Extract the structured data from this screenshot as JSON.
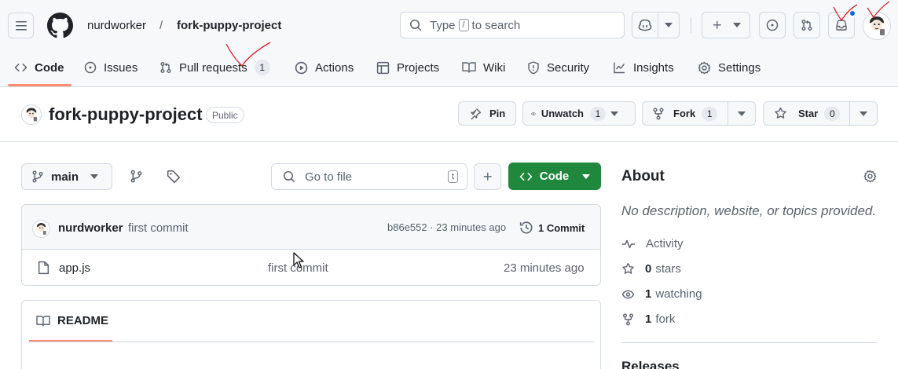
{
  "header": {
    "owner": "nurdworker",
    "separator": "/",
    "repo": "fork-puppy-project",
    "search_prefix": "Type",
    "search_key": "/",
    "search_suffix": "to search"
  },
  "nav": {
    "tabs": [
      {
        "label": "Code",
        "icon": "code-icon",
        "selected": true
      },
      {
        "label": "Issues",
        "icon": "issue-icon"
      },
      {
        "label": "Pull requests",
        "icon": "pull-request-icon",
        "count": "1"
      },
      {
        "label": "Actions",
        "icon": "play-icon"
      },
      {
        "label": "Projects",
        "icon": "table-icon"
      },
      {
        "label": "Wiki",
        "icon": "book-icon"
      },
      {
        "label": "Security",
        "icon": "shield-icon"
      },
      {
        "label": "Insights",
        "icon": "graph-icon"
      },
      {
        "label": "Settings",
        "icon": "gear-icon"
      }
    ]
  },
  "repo_header": {
    "name": "fork-puppy-project",
    "visibility": "Public",
    "pin_label": "Pin",
    "unwatch_label": "Unwatch",
    "unwatch_count": "1",
    "fork_label": "Fork",
    "fork_count": "1",
    "star_label": "Star",
    "star_count": "0"
  },
  "toolbar": {
    "branch": "main",
    "goto_placeholder": "Go to file",
    "goto_key": "t",
    "code_label": "Code"
  },
  "commit": {
    "author": "nurdworker",
    "message": "first commit",
    "hash_time": "b86e552 · 23 minutes ago",
    "commits_label": "1 Commit"
  },
  "files": [
    {
      "name": "app.js",
      "message": "first commit",
      "time": "23 minutes ago"
    }
  ],
  "readme": {
    "tab_label": "README"
  },
  "about": {
    "title": "About",
    "description": "No description, website, or topics provided.",
    "activity": "Activity",
    "stars_count": "0",
    "stars_label": "stars",
    "watching_count": "1",
    "watching_label": "watching",
    "forks_count": "1",
    "forks_label": "fork",
    "releases_title": "Releases"
  },
  "colors": {
    "accent_green": "#1f883d",
    "selected_tab_underline": "#fd8c73",
    "notification_dot": "#0969da",
    "annotation_red": "#e0202a"
  }
}
